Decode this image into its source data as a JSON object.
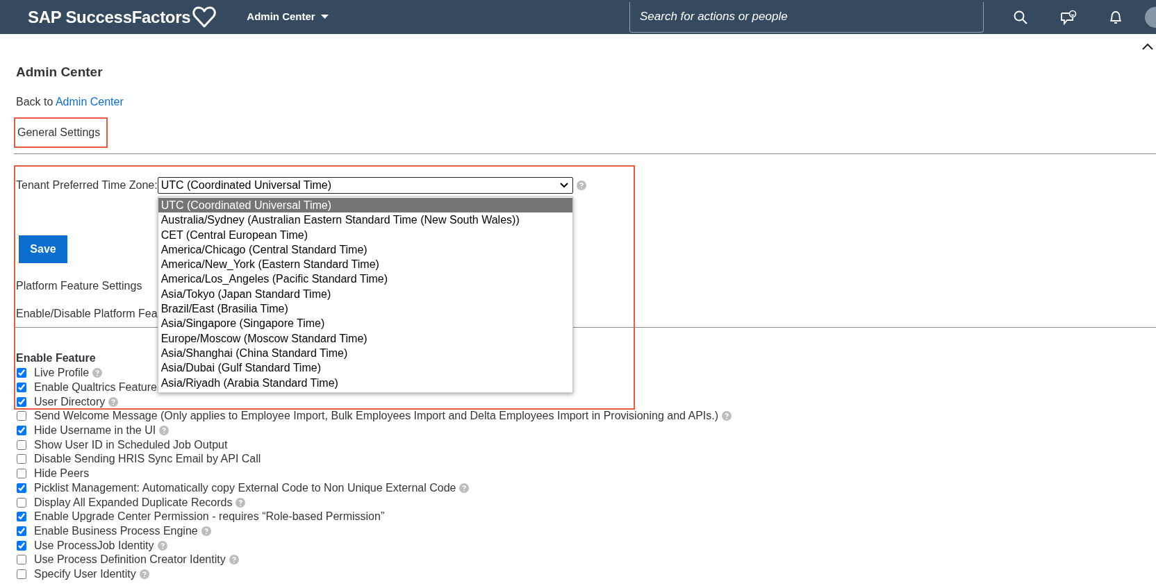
{
  "header": {
    "logo": "SAP SuccessFactors",
    "menu": "Admin Center",
    "search": {
      "placeholder": "Search for actions or people"
    }
  },
  "page": {
    "title": "Admin Center",
    "back_prefix": "Back to",
    "back_link": "Admin Center",
    "section": {
      "label": "General Settings",
      "highlighted": true
    },
    "timezone": {
      "label": "Tenant Preferred Time Zone:",
      "value": "UTC (Coordinated Universal Time)",
      "expanded": true,
      "highlighted": true,
      "options": [
        {
          "label": "UTC (Coordinated Universal Time)",
          "selected": true
        },
        {
          "label": "Australia/Sydney (Australian Eastern Standard Time (New South Wales))",
          "selected": false
        },
        {
          "label": "CET (Central European Time)",
          "selected": false
        },
        {
          "label": "America/Chicago (Central Standard Time)",
          "selected": false
        },
        {
          "label": "America/New_York (Eastern Standard Time)",
          "selected": false
        },
        {
          "label": "America/Los_Angeles (Pacific Standard Time)",
          "selected": false
        },
        {
          "label": "Asia/Tokyo (Japan Standard Time)",
          "selected": false
        },
        {
          "label": "Brazil/East (Brasilia Time)",
          "selected": false
        },
        {
          "label": "Asia/Singapore (Singapore Time)",
          "selected": false
        },
        {
          "label": "Europe/Moscow (Moscow Standard Time)",
          "selected": false
        },
        {
          "label": "Asia/Shanghai (China Standard Time)",
          "selected": false
        },
        {
          "label": "Asia/Dubai (Gulf Standard Time)",
          "selected": false
        },
        {
          "label": "Asia/Riyadh (Arabia Standard Time)",
          "selected": false
        }
      ]
    },
    "save": "Save",
    "platform_heading": "Platform Feature Settings",
    "platform_text": "Enable/Disable Platform Fea",
    "feature_heading": "Enable Feature",
    "features": [
      {
        "label": "Live Profile",
        "checked": true,
        "help": true
      },
      {
        "label": "Enable Qualtrics Feature",
        "checked": true,
        "help": false
      },
      {
        "label": "User Directory",
        "checked": true,
        "help": true
      },
      {
        "label": "Send Welcome Message (Only applies to Employee Import, Bulk Employees Import and Delta Employees Import in Provisioning and APIs.)",
        "checked": false,
        "help": true
      },
      {
        "label": "Hide Username in the UI",
        "checked": true,
        "help": true
      },
      {
        "label": "Show User ID in Scheduled Job Output",
        "checked": false,
        "help": false
      },
      {
        "label": "Disable Sending HRIS Sync Email by API Call",
        "checked": false,
        "help": false
      },
      {
        "label": "Hide Peers",
        "checked": false,
        "help": false
      },
      {
        "label": "Picklist Management: Automatically copy External Code to Non Unique External Code",
        "checked": true,
        "help": true
      },
      {
        "label": "Display All Expanded Duplicate Records",
        "checked": false,
        "help": true
      },
      {
        "label": "Enable Upgrade Center Permission - requires “Role-based Permission”",
        "checked": true,
        "help": false
      },
      {
        "label": "Enable Business Process Engine",
        "checked": true,
        "help": true
      },
      {
        "label": "Use ProcessJob Identity",
        "checked": true,
        "help": true
      },
      {
        "label": "Use Process Definition Creator Identity",
        "checked": false,
        "help": true
      },
      {
        "label": "Specify User Identity",
        "checked": false,
        "help": true
      }
    ]
  }
}
